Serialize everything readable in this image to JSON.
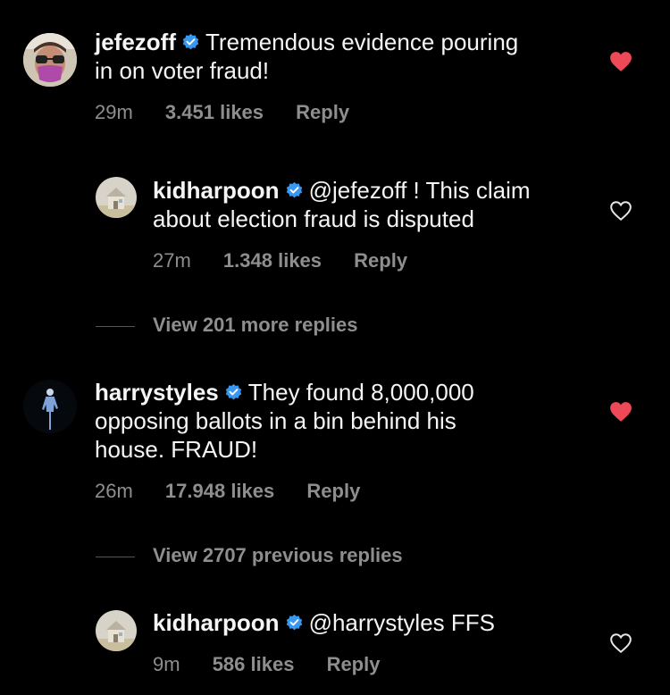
{
  "comments": [
    {
      "username": "jefezoff",
      "text_line1": "Tremendous evidence pouring",
      "text_line2": "in on voter fraud!",
      "time": "29m",
      "likes": "3.451 likes",
      "reply": "Reply",
      "liked": true,
      "avatar_icon": "person-with-sunglasses-mask-avatar"
    },
    {
      "username": "kidharpoon",
      "text_line1": "@jefezoff ! This claim",
      "text_line2": "about election fraud is disputed",
      "time": "27m",
      "likes": "1.348 likes",
      "reply": "Reply",
      "liked": false,
      "avatar_icon": "house-avatar"
    },
    {
      "view_more": "View 201 more replies"
    },
    {
      "username": "harrystyles",
      "text_line1": "They found 8,000,000",
      "text_line2": "opposing ballots in a bin behind his",
      "text_line3": "house. FRAUD!",
      "time": "26m",
      "likes": "17.948 likes",
      "reply": "Reply",
      "liked": true,
      "avatar_icon": "standing-figure-avatar"
    },
    {
      "view_more": "View 2707 previous replies"
    },
    {
      "username": "kidharpoon",
      "text_line1": "@harrystyles FFS",
      "time": "9m",
      "likes": "586 likes",
      "reply": "Reply",
      "liked": false,
      "avatar_icon": "house-avatar"
    }
  ],
  "colors": {
    "background": "#000000",
    "text": "#f5f5f5",
    "secondary_text": "#8e8e8e",
    "verified": "#3897f0",
    "heart_liked": "#ed4956"
  }
}
